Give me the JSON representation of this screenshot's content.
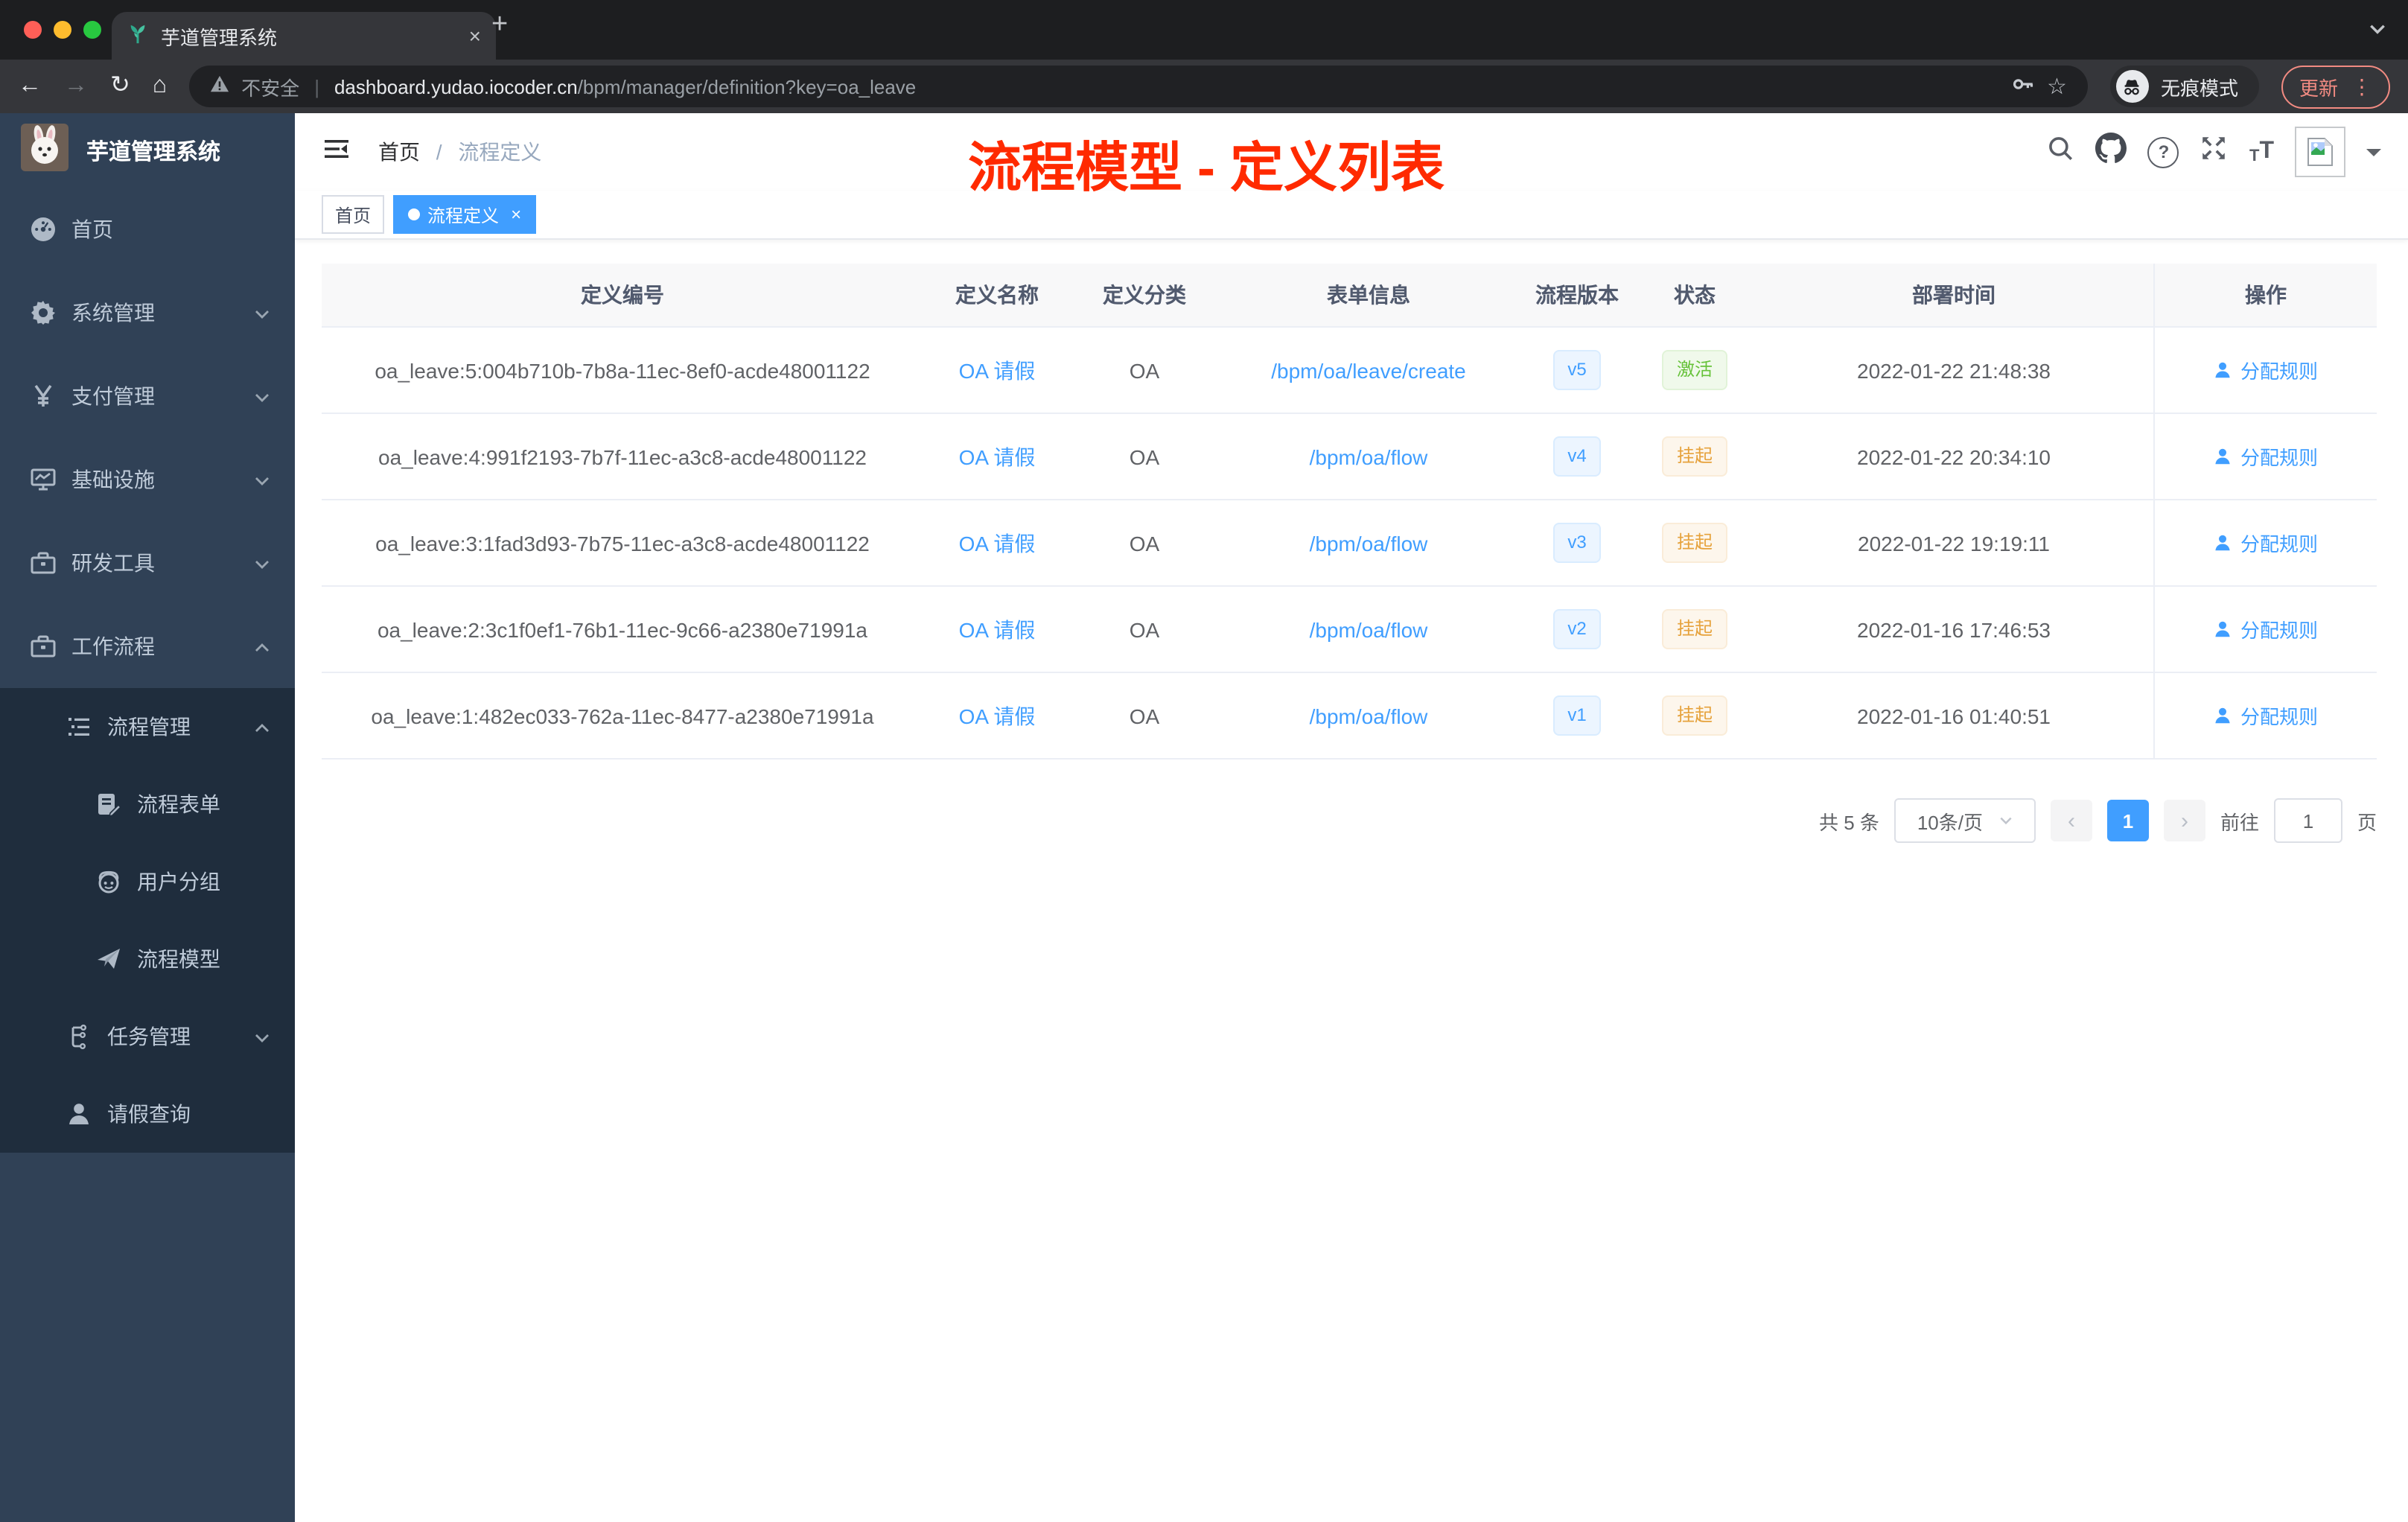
{
  "colors": {
    "accent": "#409eff",
    "sidebar-bg": "#304156",
    "submenu-bg": "#1f2d3d",
    "sidebar-text": "#bfcbd9",
    "success": "#67c23a",
    "warning": "#e6a23c",
    "title-red": "#ff2a00",
    "chrome-strip": "#1d1e20",
    "chrome-tab": "#35363a",
    "chrome-pill": "#202124",
    "update-chip": "#f28b82",
    "table-border": "#ebeef5",
    "header-band": "#f8f8f9",
    "text-main": "#606266"
  },
  "browser": {
    "tab_title": "芋道管理系统",
    "tab_close": "×",
    "new_tab": "+",
    "back": "←",
    "forward": "→",
    "reload": "↻",
    "home": "⌂",
    "security_label": "不安全",
    "url_divider": "|",
    "url_host": "dashboard.yudao.iocoder.cn",
    "url_path": "/bpm/manager/definition?key=oa_leave",
    "star": "☆",
    "incognito_label": "无痕模式",
    "update_label": "更新",
    "more_menu": "⋮"
  },
  "sidebar": {
    "app_title": "芋道管理系统",
    "items": [
      {
        "label": "首页"
      },
      {
        "label": "系统管理"
      },
      {
        "label": "支付管理"
      },
      {
        "label": "基础设施"
      },
      {
        "label": "研发工具"
      },
      {
        "label": "工作流程"
      },
      {
        "label": "流程管理"
      },
      {
        "label": "流程表单"
      },
      {
        "label": "用户分组"
      },
      {
        "label": "流程模型"
      },
      {
        "label": "任务管理"
      },
      {
        "label": "请假查询"
      }
    ]
  },
  "header": {
    "breadcrumb_home": "首页",
    "breadcrumb_sep": "/",
    "breadcrumb_current": "流程定义",
    "help_glyph": "?",
    "font_small": "T",
    "font_large": "T",
    "overlay_title": "流程模型 - 定义列表"
  },
  "tags": {
    "home": "首页",
    "active": "流程定义",
    "close": "×"
  },
  "table": {
    "columns": [
      "定义编号",
      "定义名称",
      "定义分类",
      "表单信息",
      "流程版本",
      "状态",
      "部署时间",
      "操作"
    ],
    "rows": [
      {
        "id": "oa_leave:5:004b710b-7b8a-11ec-8ef0-acde48001122",
        "name": "OA 请假",
        "category": "OA",
        "form": "/bpm/oa/leave/create",
        "version": "v5",
        "status": "激活",
        "deployed": "2022-01-22 21:48:38",
        "action": "分配规则"
      },
      {
        "id": "oa_leave:4:991f2193-7b7f-11ec-a3c8-acde48001122",
        "name": "OA 请假",
        "category": "OA",
        "form": "/bpm/oa/flow",
        "version": "v4",
        "status": "挂起",
        "deployed": "2022-01-22 20:34:10",
        "action": "分配规则"
      },
      {
        "id": "oa_leave:3:1fad3d93-7b75-11ec-a3c8-acde48001122",
        "name": "OA 请假",
        "category": "OA",
        "form": "/bpm/oa/flow",
        "version": "v3",
        "status": "挂起",
        "deployed": "2022-01-22 19:19:11",
        "action": "分配规则"
      },
      {
        "id": "oa_leave:2:3c1f0ef1-76b1-11ec-9c66-a2380e71991a",
        "name": "OA 请假",
        "category": "OA",
        "form": "/bpm/oa/flow",
        "version": "v2",
        "status": "挂起",
        "deployed": "2022-01-16 17:46:53",
        "action": "分配规则"
      },
      {
        "id": "oa_leave:1:482ec033-762a-11ec-8477-a2380e71991a",
        "name": "OA 请假",
        "category": "OA",
        "form": "/bpm/oa/flow",
        "version": "v1",
        "status": "挂起",
        "deployed": "2022-01-16 01:40:51",
        "action": "分配规则"
      }
    ]
  },
  "pagination": {
    "total": "共 5 条",
    "page_size": "10条/页",
    "prev": "‹",
    "current": "1",
    "next": "›",
    "goto_label": "前往",
    "goto_value": "1",
    "unit": "页"
  }
}
